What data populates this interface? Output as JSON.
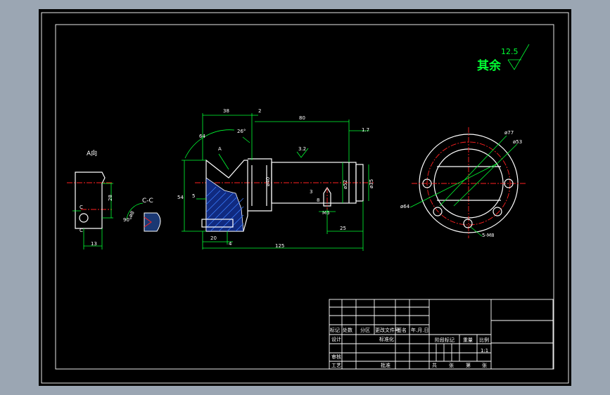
{
  "surface_finish": {
    "label": "其余",
    "value": "12.5"
  },
  "views": {
    "a_view_label": "A向",
    "cc_view_label": "C-C",
    "a_arrow_label": "A"
  },
  "dimensions": {
    "d38": "38",
    "d2": "2",
    "d80": "80",
    "d1_7": "1.7",
    "d64_arc": "64",
    "d26deg": "26°",
    "ra3_2": "3.2",
    "phi40": "ø40",
    "phi52": "ø52",
    "phi35": "ø35",
    "d3": "3",
    "d8": "8",
    "m6": "M6",
    "d54": "54",
    "d5": "5",
    "d20": "20",
    "d4": "4",
    "d125": "125",
    "d25": "25",
    "d28": "28",
    "d13": "13",
    "c_mark": "C",
    "d90deg": "90°",
    "phi8": "ø8",
    "phi77": "ø77",
    "phi53": "ø53",
    "phi64": "ø64",
    "m8_holes": "5-M8"
  },
  "title_block": {
    "row_labels": [
      "标记",
      "处数",
      "分区",
      "更改文件号",
      "签名",
      "年.月.日"
    ],
    "design": "设计",
    "standard": "标准化",
    "review": "审核",
    "process": "工艺",
    "approve": "批准",
    "stage_mark": "阶段标记",
    "weight": "重量",
    "scale": "比例",
    "scale_value": "1:1",
    "sheets": "共",
    "sheet_of": "张",
    "sheet_no": "第",
    "sheet_no_unit": "张"
  },
  "colors": {
    "background": "#000000",
    "dimension": "#00ff33",
    "object_line": "#ffffff",
    "center_line": "#ff2020",
    "hatch": "#3a7cff"
  }
}
